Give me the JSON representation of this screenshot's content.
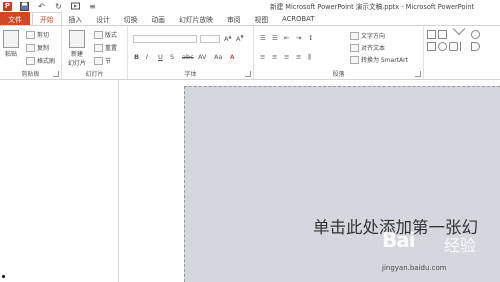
{
  "title_bar": {
    "document_title": "新建 Microsoft PowerPoint 演示文稿.pptx - Microsoft PowerPoint",
    "qat_icons": [
      "powerpoint-logo",
      "save-icon",
      "undo-icon",
      "redo-icon",
      "start-icon",
      "customize-icon"
    ]
  },
  "ribbon_tabs": {
    "file": "文件",
    "tabs": [
      "开始",
      "插入",
      "设计",
      "切换",
      "动画",
      "幻灯片放映",
      "审阅",
      "视图",
      "ACROBAT"
    ],
    "active": "开始"
  },
  "clipboard": {
    "paste": "粘贴",
    "cut": "剪切",
    "copy": "复制",
    "format_painter": "格式刷",
    "label": "剪贴板"
  },
  "slides_group": {
    "new_slide_line1": "新建",
    "new_slide_line2": "幻灯片",
    "layout": "版式",
    "reset": "重置",
    "section": "节",
    "label": "幻灯片"
  },
  "font_group": {
    "label": "字体",
    "buttons": [
      "B",
      "I",
      "U",
      "S",
      "abc",
      "AV",
      "Aa",
      "A"
    ]
  },
  "paragraph_group": {
    "text_direction": "文字方向",
    "align_text": "对齐文本",
    "convert_smartart": "转换为 SmartArt",
    "label": "段落"
  },
  "slide": {
    "title_placeholder": "单击此处添加第一张幻"
  },
  "watermark": {
    "logo": "Bai",
    "text": "经验",
    "url": "jingyan.baidu.com"
  }
}
